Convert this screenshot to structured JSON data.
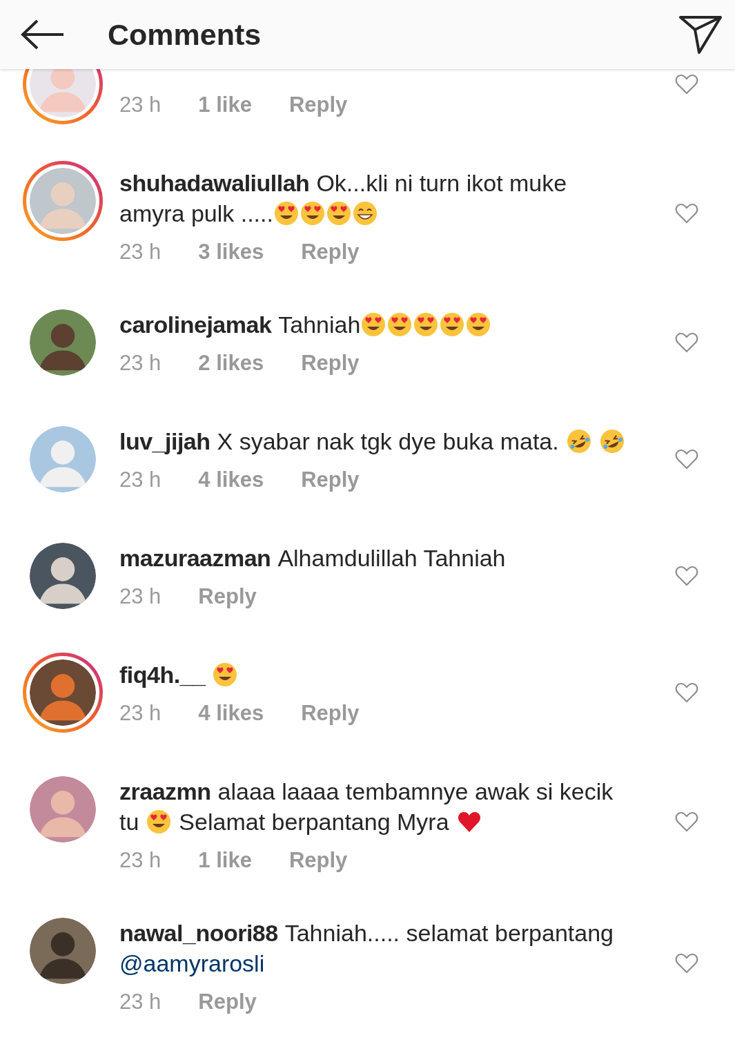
{
  "header": {
    "title": "Comments"
  },
  "comments": [
    {
      "story_ring": true,
      "time": "23 h",
      "likes": "1 like",
      "reply": "Reply"
    },
    {
      "story_ring": true,
      "user": "shuhadawaliullah",
      "lines": [
        [
          {
            "kind": "text",
            "text": "Ok...kli ni turn ikot muke"
          }
        ],
        [
          {
            "kind": "text",
            "text": "amyra pulk ....."
          },
          {
            "kind": "heart-eyes"
          },
          {
            "kind": "heart-eyes"
          },
          {
            "kind": "heart-eyes"
          },
          {
            "kind": "grin"
          }
        ]
      ],
      "time": "23 h",
      "likes": "3 likes",
      "reply": "Reply"
    },
    {
      "story_ring": false,
      "user": "carolinejamak",
      "lines": [
        [
          {
            "kind": "text",
            "text": "Tahniah"
          },
          {
            "kind": "heart-eyes"
          },
          {
            "kind": "heart-eyes"
          },
          {
            "kind": "heart-eyes"
          },
          {
            "kind": "heart-eyes"
          },
          {
            "kind": "heart-eyes"
          }
        ]
      ],
      "time": "23 h",
      "likes": "2 likes",
      "reply": "Reply"
    },
    {
      "story_ring": false,
      "user": "luv_jijah",
      "lines": [
        [
          {
            "kind": "text",
            "text": "X syabar nak tgk dye buka mata."
          },
          {
            "kind": "rofl"
          },
          {
            "kind": "rofl"
          }
        ]
      ],
      "time": "23 h",
      "likes": "4 likes",
      "reply": "Reply"
    },
    {
      "story_ring": false,
      "user": "mazuraazman",
      "lines": [
        [
          {
            "kind": "text",
            "text": "Alhamdulillah Tahniah"
          }
        ]
      ],
      "time": "23 h",
      "reply": "Reply"
    },
    {
      "story_ring": true,
      "user": "fiq4h.__",
      "lines": [
        [
          {
            "kind": "heart-eyes"
          }
        ]
      ],
      "time": "23 h",
      "likes": "4 likes",
      "reply": "Reply"
    },
    {
      "story_ring": false,
      "user": "zraazmn",
      "lines": [
        [
          {
            "kind": "text",
            "text": "alaaa laaaa tembamnye awak si kecik"
          }
        ],
        [
          {
            "kind": "text",
            "text": "tu"
          },
          {
            "kind": "heart-eyes"
          },
          {
            "kind": "text",
            "text": "Selamat berpantang Myra"
          },
          {
            "kind": "red-heart"
          }
        ]
      ],
      "time": "23 h",
      "likes": "1 like",
      "reply": "Reply"
    },
    {
      "story_ring": false,
      "user": "nawal_noori88",
      "lines": [
        [
          {
            "kind": "text",
            "text": "Tahniah..... selamat berpantang"
          }
        ],
        [
          {
            "kind": "mention",
            "text": "@aamyrarosli"
          }
        ]
      ],
      "time": "23 h",
      "reply": "Reply"
    }
  ]
}
